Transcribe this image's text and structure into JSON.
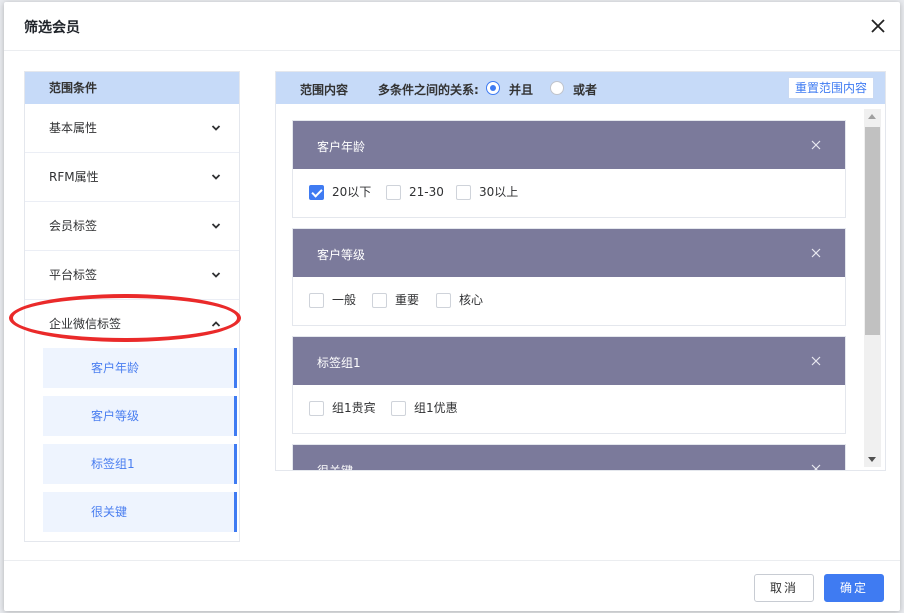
{
  "dialog": {
    "title": "筛选会员"
  },
  "left_panel": {
    "header": "范围条件",
    "menu_items": [
      {
        "label": "基本属性"
      },
      {
        "label": "RFM属性"
      },
      {
        "label": "会员标签"
      },
      {
        "label": "平台标签"
      },
      {
        "label": "企业微信标签"
      }
    ],
    "sub_items": [
      {
        "label": "客户年龄"
      },
      {
        "label": "客户等级"
      },
      {
        "label": "标签组1"
      },
      {
        "label": "很关键"
      }
    ]
  },
  "right_panel": {
    "header": "范围内容",
    "relation_label": "多条件之间的关系:",
    "relation_options": [
      "并且",
      "或者"
    ],
    "relation_selected": "并且",
    "reset_button": "重置范围内容",
    "cards": [
      {
        "title": "客户年龄",
        "options": [
          {
            "label": "20以下",
            "checked": true
          },
          {
            "label": "21-30",
            "checked": false
          },
          {
            "label": "30以上",
            "checked": false
          }
        ]
      },
      {
        "title": "客户等级",
        "options": [
          {
            "label": "一般",
            "checked": false
          },
          {
            "label": "重要",
            "checked": false
          },
          {
            "label": "核心",
            "checked": false
          }
        ]
      },
      {
        "title": "标签组1",
        "options": [
          {
            "label": "组1贵宾",
            "checked": false
          },
          {
            "label": "组1优惠",
            "checked": false
          }
        ]
      },
      {
        "title": "很关键",
        "options": []
      }
    ]
  },
  "footer": {
    "cancel": "取消",
    "ok": "确定"
  },
  "colors": {
    "accent": "#3f7bf2",
    "header_bg": "#c6daf8",
    "card_header": "#7b7a9b",
    "annotation": "#ea2a2a"
  }
}
